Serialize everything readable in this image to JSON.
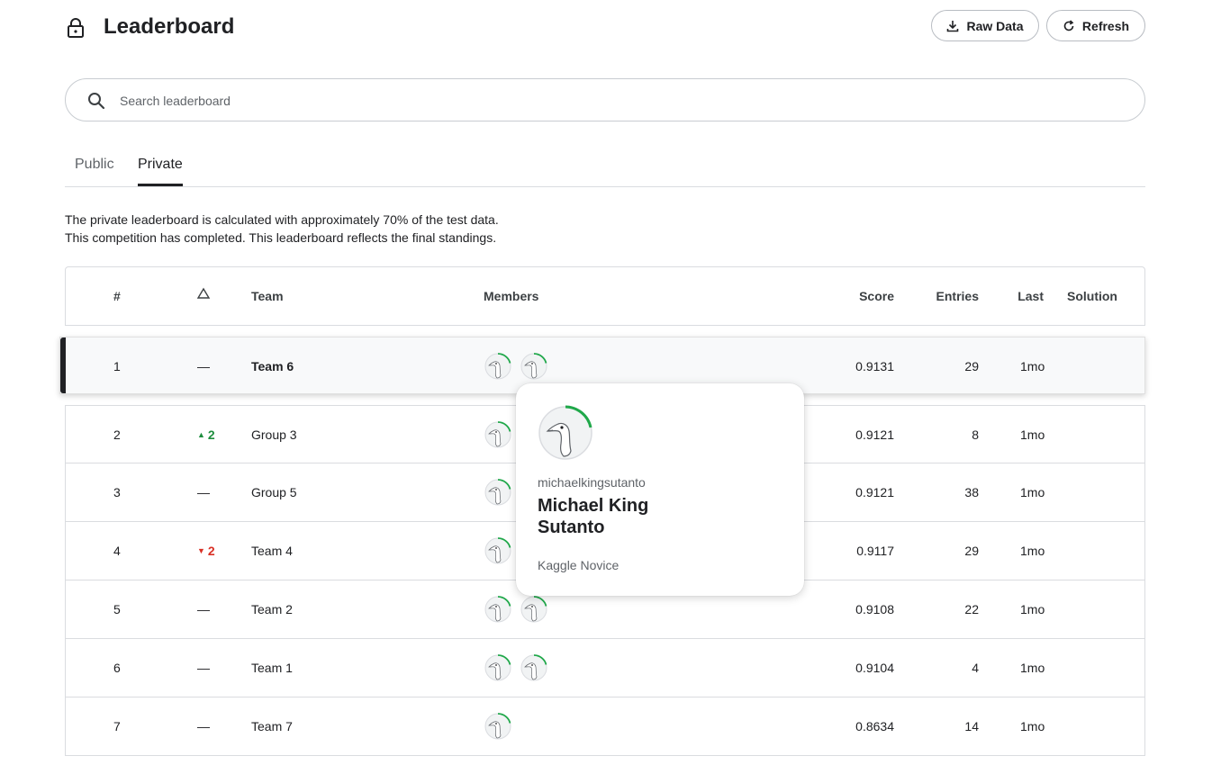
{
  "header": {
    "title": "Leaderboard",
    "raw_data_label": "Raw Data",
    "refresh_label": "Refresh"
  },
  "search": {
    "placeholder": "Search leaderboard",
    "value": ""
  },
  "tabs": [
    {
      "label": "Public",
      "active": false
    },
    {
      "label": "Private",
      "active": true
    }
  ],
  "description": {
    "line1": "The private leaderboard is calculated with approximately 70% of the test data.",
    "line2": "This competition has completed. This leaderboard reflects the final standings."
  },
  "table": {
    "columns": {
      "rank": "#",
      "team": "Team",
      "members": "Members",
      "score": "Score",
      "entries": "Entries",
      "last": "Last",
      "solution": "Solution"
    },
    "rows": [
      {
        "rank": "1",
        "delta": "—",
        "delta_dir": "none",
        "team": "Team 6",
        "members": 2,
        "score": "0.9131",
        "entries": "29",
        "last": "1mo"
      },
      {
        "rank": "2",
        "delta": "2",
        "delta_dir": "up",
        "team": "Group 3",
        "members": 2,
        "score": "0.9121",
        "entries": "8",
        "last": "1mo"
      },
      {
        "rank": "3",
        "delta": "—",
        "delta_dir": "none",
        "team": "Group 5",
        "members": 2,
        "score": "0.9121",
        "entries": "38",
        "last": "1mo"
      },
      {
        "rank": "4",
        "delta": "2",
        "delta_dir": "down",
        "team": "Team 4",
        "members": 2,
        "score": "0.9117",
        "entries": "29",
        "last": "1mo"
      },
      {
        "rank": "5",
        "delta": "—",
        "delta_dir": "none",
        "team": "Team 2",
        "members": 2,
        "score": "0.9108",
        "entries": "22",
        "last": "1mo"
      },
      {
        "rank": "6",
        "delta": "—",
        "delta_dir": "none",
        "team": "Team 1",
        "members": 2,
        "score": "0.9104",
        "entries": "4",
        "last": "1mo"
      },
      {
        "rank": "7",
        "delta": "—",
        "delta_dir": "none",
        "team": "Team 7",
        "members": 1,
        "score": "0.8634",
        "entries": "14",
        "last": "1mo"
      }
    ]
  },
  "popover": {
    "username": "michaelkingsutanto",
    "display_name": "Michael King Sutanto",
    "tier": "Kaggle Novice"
  },
  "colors": {
    "progress_ring": "#20a84a",
    "delta_up": "#1e8e3e",
    "delta_down": "#d93025"
  },
  "icons": {
    "header": "lock-icon",
    "raw_data": "download-icon",
    "refresh": "refresh-icon",
    "search": "search-icon",
    "delta_header": "triangle-icon",
    "avatar": "goose-avatar-icon"
  }
}
